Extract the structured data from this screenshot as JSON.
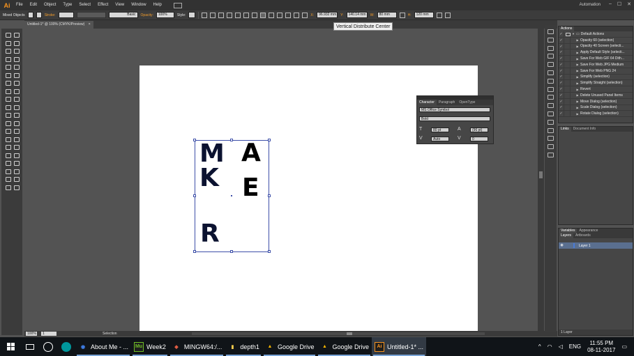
{
  "app": {
    "logo": "Ai",
    "menus": [
      "File",
      "Edit",
      "Object",
      "Type",
      "Select",
      "Effect",
      "View",
      "Window",
      "Help"
    ],
    "workspace": "Automation",
    "window_buttons": [
      "–",
      "☐",
      "✕"
    ]
  },
  "controlbar": {
    "selection_label": "Mixed Objects",
    "stroke_label": "Stroke:",
    "brush_label": "Basic",
    "opacity_label": "Opacity:",
    "opacity_value": "100%",
    "style_label": "Style:",
    "x_label": "X:",
    "x_value": "96.932 mm",
    "y_label": "Y:",
    "y_value": "140.14 mm",
    "w_label": "W:",
    "w_value": "80 mm",
    "h_label": "H:",
    "h_value": "120 mm"
  },
  "document": {
    "tab_title": "Untitled-1* @ 100% (CMYK/Preview)",
    "close": "×"
  },
  "tooltip": "Vertical Distribute Center",
  "artwork": {
    "letters": [
      {
        "id": "M",
        "text": "M",
        "selected": true
      },
      {
        "id": "K",
        "text": "K",
        "selected": true
      },
      {
        "id": "R",
        "text": "R",
        "selected": true
      },
      {
        "id": "A",
        "text": "A",
        "selected": false
      },
      {
        "id": "E",
        "text": "E",
        "selected": false
      }
    ]
  },
  "character_panel": {
    "tabs": [
      "Character",
      "Paragraph",
      "OpenType"
    ],
    "font_family": "MS Office Symbol",
    "font_style": "Bold",
    "font_size": "80 pt",
    "leading": "(96 pt)",
    "kerning": "Auto",
    "tracking": "0"
  },
  "actions_panel": {
    "tabs": [
      "Actions"
    ],
    "items": [
      {
        "name": "Default Actions",
        "type": "folder"
      },
      {
        "name": "Opacity 60 (selection)",
        "type": "item"
      },
      {
        "name": "Opacity 40 Screen (selecti...",
        "type": "item"
      },
      {
        "name": "Apply Default Style (selecti...",
        "type": "item"
      },
      {
        "name": "Save For Web GIF 64 Dith...",
        "type": "item"
      },
      {
        "name": "Save For Web JPG Medium",
        "type": "item"
      },
      {
        "name": "Save For Web PNG 24",
        "type": "item"
      },
      {
        "name": "Simplify (selection)",
        "type": "item"
      },
      {
        "name": "Simplify Straight (selection)",
        "type": "item"
      },
      {
        "name": "Revert",
        "type": "item"
      },
      {
        "name": "Delete Unused Panel Items",
        "type": "item"
      },
      {
        "name": "Move Dialog (selection)",
        "type": "item"
      },
      {
        "name": "Scale Dialog (selection)",
        "type": "item"
      },
      {
        "name": "Rotate Dialog (selection)",
        "type": "item"
      }
    ]
  },
  "links_panel": {
    "tabs": [
      "Links",
      "Document Info"
    ]
  },
  "variables_panel": {
    "tabs": [
      "Variables",
      "Appearance"
    ]
  },
  "layers_panel": {
    "tabs": [
      "Layers",
      "Artboards"
    ],
    "layers": [
      {
        "name": "Layer 1"
      }
    ],
    "footer": "1 Layer"
  },
  "statusbar": {
    "zoom": "100%",
    "page": "1",
    "status": "Selection"
  },
  "taskbar": {
    "apps": [
      {
        "label": "About Me - ...",
        "icon": "chrome-icon",
        "color": "#4285f4",
        "glyph": "◉"
      },
      {
        "label": "Week2",
        "icon": "muse-icon",
        "color": "#6fbf26",
        "glyph": "Mu"
      },
      {
        "label": "MINGW64:/...",
        "icon": "git-icon",
        "color": "#e05d44",
        "glyph": "◆"
      },
      {
        "label": "depth1",
        "icon": "folder-icon",
        "color": "#f2c94c",
        "glyph": "▮"
      },
      {
        "label": "Google Drive",
        "icon": "drive-icon",
        "color": "#f4b400",
        "glyph": "▲"
      },
      {
        "label": "Google Drive",
        "icon": "drive-icon",
        "color": "#f4b400",
        "glyph": "▲"
      },
      {
        "label": "Untitled-1* ...",
        "icon": "illustrator-icon",
        "color": "#f7931e",
        "glyph": "Ai",
        "active": true
      }
    ],
    "lang": "ENG",
    "time": "11:55 PM",
    "date": "08-11-2017"
  }
}
